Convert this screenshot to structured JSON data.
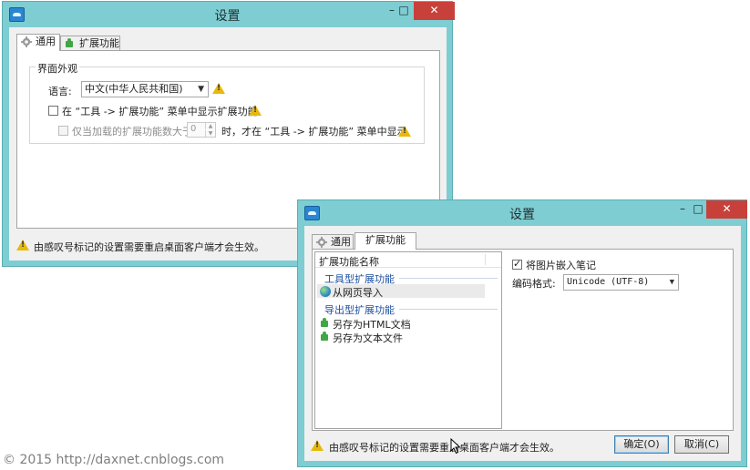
{
  "watermark": "© 2015 http://daxnet.cnblogs.com",
  "window_controls": {
    "minimize": "–",
    "maximize": "□",
    "close": "✕"
  },
  "back_window": {
    "title": "设置",
    "tabs": [
      {
        "label": "通用",
        "icon": "gear-icon"
      },
      {
        "label": "扩展功能",
        "icon": "puzzle-icon"
      }
    ],
    "group_title": "界面外观",
    "language_label": "语言:",
    "language_value": "中文(中华人民共和国)",
    "show_ext_label": "在 “工具 -> 扩展功能” 菜单中显示扩展功能",
    "show_ext_checked": false,
    "only_when_prefix": "仅当加载的扩展功能数大于",
    "only_when_value": "0",
    "only_when_suffix": "时，才在 “工具 -> 扩展功能” 菜单中显示",
    "footer_note": "由感叹号标记的设置需要重启桌面客户端才会生效。"
  },
  "front_window": {
    "title": "设置",
    "tabs": [
      {
        "label": "通用",
        "icon": "gear-icon"
      },
      {
        "label": "扩展功能"
      }
    ],
    "list_header": "扩展功能名称",
    "groups": [
      {
        "title": "工具型扩展功能",
        "items": [
          {
            "label": "从网页导入",
            "icon": "globe-icon",
            "selected": true
          }
        ]
      },
      {
        "title": "导出型扩展功能",
        "items": [
          {
            "label": "另存为HTML文档",
            "icon": "puzzle-icon"
          },
          {
            "label": "另存为文本文件",
            "icon": "puzzle-icon"
          }
        ]
      }
    ],
    "embed_images_label": "将图片嵌入笔记",
    "embed_images_checked": true,
    "encoding_label": "编码格式:",
    "encoding_value": "Unicode (UTF-8)",
    "footer_note": "由感叹号标记的设置需要重启桌面客户端才会生效。",
    "ok_label": "确定(O)",
    "cancel_label": "取消(C)"
  }
}
